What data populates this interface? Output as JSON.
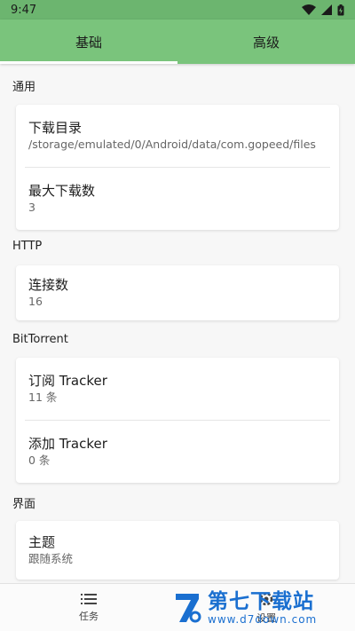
{
  "status_bar": {
    "time": "9:47"
  },
  "tabs": [
    {
      "label": "基础",
      "active": true
    },
    {
      "label": "高级",
      "active": false
    }
  ],
  "sections": {
    "general": {
      "title": "通用",
      "items": [
        {
          "title": "下载目录",
          "value": "/storage/emulated/0/Android/data/com.gopeed/files"
        },
        {
          "title": "最大下载数",
          "value": "3"
        }
      ]
    },
    "http": {
      "title": "HTTP",
      "items": [
        {
          "title": "连接数",
          "value": "16"
        }
      ]
    },
    "bittorrent": {
      "title": "BitTorrent",
      "items": [
        {
          "title": "订阅 Tracker",
          "value": "11 条"
        },
        {
          "title": "添加 Tracker",
          "value": "0 条"
        }
      ]
    },
    "ui": {
      "title": "界面",
      "items": [
        {
          "title": "主题",
          "value": "跟随系统"
        }
      ]
    }
  },
  "bottom_nav": {
    "tasks_label": "任务",
    "settings_label": "设置"
  },
  "watermark": {
    "title": "第七下载站",
    "url": "www.d7down.com"
  },
  "colors": {
    "app_bar": "#7ac47c",
    "status_bar": "#6cb56f",
    "watermark": "#1a6fd0"
  }
}
